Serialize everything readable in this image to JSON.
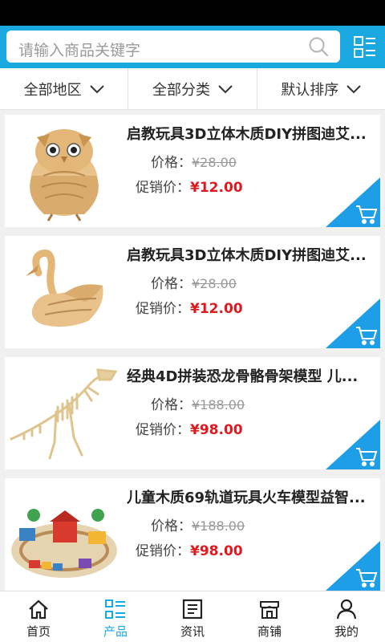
{
  "search": {
    "placeholder": "请输入商品关键字"
  },
  "filters": [
    "全部地区",
    "全部分类",
    "默认排序"
  ],
  "labels": {
    "price": "价格：",
    "promo": "促销价："
  },
  "products": [
    {
      "title": "启教玩具3D立体木质DIY拼图迪艾...",
      "price": "¥28.00",
      "promo_price": "¥12.00",
      "image": "owl"
    },
    {
      "title": "启教玩具3D立体木质DIY拼图迪艾...",
      "price": "¥28.00",
      "promo_price": "¥12.00",
      "image": "swan"
    },
    {
      "title": "经典4D拼装恐龙骨骼骨架模型 儿...",
      "price": "¥188.00",
      "promo_price": "¥98.00",
      "image": "dinosaur"
    },
    {
      "title": "儿童木质69轨道玩具火车模型益智...",
      "price": "¥188.00",
      "promo_price": "¥98.00",
      "image": "train-set"
    }
  ],
  "tabs": [
    {
      "label": "首页",
      "icon": "home-icon"
    },
    {
      "label": "产品",
      "icon": "product-list-icon",
      "active": true
    },
    {
      "label": "资讯",
      "icon": "news-icon"
    },
    {
      "label": "商铺",
      "icon": "shop-icon"
    },
    {
      "label": "我的",
      "icon": "user-icon"
    }
  ],
  "colors": {
    "accent": "#19a9e0",
    "promo": "#e0191f"
  }
}
